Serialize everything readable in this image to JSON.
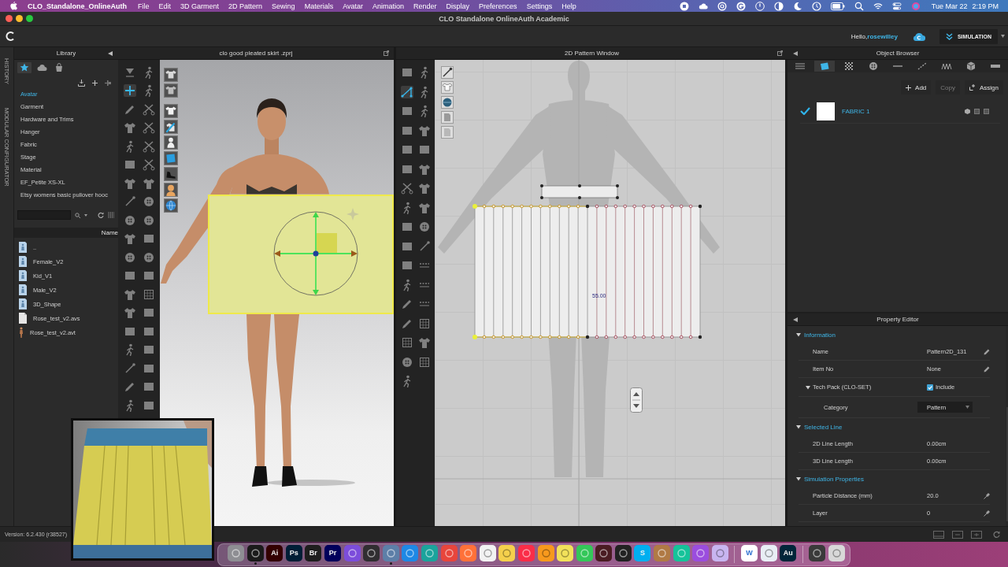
{
  "menu_bar": {
    "app_name": "CLO_Standalone_OnlineAuth",
    "menus": [
      "File",
      "Edit",
      "3D Garment",
      "2D Pattern",
      "Sewing",
      "Materials",
      "Avatar",
      "Animation",
      "Render",
      "Display",
      "Preferences",
      "Settings",
      "Help"
    ],
    "date": "Tue Mar 22",
    "time": "2:19 PM"
  },
  "window": {
    "title": "CLO Standalone OnlineAuth Academic"
  },
  "top_bar": {
    "greeting": "Hello,",
    "user": "rosewilley",
    "mode_button": "SIMULATION"
  },
  "side_strip": {
    "tabs": [
      "HISTORY",
      "MODULAR CONFIGURATOR"
    ]
  },
  "library": {
    "title": "Library",
    "tabs": [
      {
        "selected": true
      },
      {
        "selected": false
      },
      {
        "selected": false
      }
    ],
    "categories": [
      {
        "label": "Avatar",
        "selected": true
      },
      {
        "label": "Garment",
        "selected": false
      },
      {
        "label": "Hardware and Trims",
        "selected": false
      },
      {
        "label": "Hanger",
        "selected": false
      },
      {
        "label": "Fabric",
        "selected": false
      },
      {
        "label": "Stage",
        "selected": false
      },
      {
        "label": "Material",
        "selected": false
      },
      {
        "label": "EF_Petite XS-XL",
        "selected": false
      },
      {
        "label": "Etsy womens basic pullover hooc",
        "selected": false
      }
    ],
    "column_header": "Name",
    "files": [
      {
        "kind": "folder",
        "name": ".."
      },
      {
        "kind": "folder",
        "name": "Female_V2"
      },
      {
        "kind": "folder",
        "name": "Kid_V1"
      },
      {
        "kind": "folder",
        "name": "Male_V2"
      },
      {
        "kind": "folder",
        "name": "3D_Shape"
      },
      {
        "kind": "file",
        "name": "Rose_test_v2.avs"
      },
      {
        "kind": "avatar",
        "name": "Rose_test_v2.avt"
      }
    ]
  },
  "viewport_3d": {
    "title": "clo good pleated skirt .zprj",
    "piece_selected": true,
    "tools": [
      {
        "selected": false
      },
      {
        "selected": false
      },
      {
        "selected": true
      },
      {
        "selected": false
      },
      {
        "selected": false
      },
      {
        "selected": false
      },
      {
        "selected": false
      },
      {
        "selected": false
      },
      {
        "selected": false
      },
      {
        "selected": false
      },
      {
        "selected": false
      },
      {
        "selected": false
      },
      {
        "selected": false
      },
      {
        "selected": false
      },
      {
        "selected": false
      },
      {
        "selected": false
      },
      {
        "selected": false
      },
      {
        "selected": false
      },
      {
        "selected": false
      },
      {
        "selected": false
      },
      {
        "selected": false
      },
      {
        "selected": false
      },
      {
        "selected": false
      },
      {
        "selected": false
      },
      {
        "selected": false
      },
      {
        "selected": false
      },
      {
        "selected": false
      },
      {
        "selected": false
      },
      {
        "selected": false
      },
      {
        "selected": false
      },
      {
        "selected": false
      },
      {
        "selected": false
      },
      {
        "selected": false
      },
      {
        "selected": false
      },
      {
        "selected": false
      },
      {
        "selected": false
      },
      {
        "selected": false
      },
      {
        "selected": false
      }
    ]
  },
  "pattern_window": {
    "title": "2D Pattern Window",
    "measure": "55.00",
    "tools": [
      {
        "selected": false
      },
      {
        "selected": false
      },
      {
        "selected": true
      },
      {
        "selected": false
      },
      {
        "selected": false
      },
      {
        "selected": false
      },
      {
        "selected": false
      },
      {
        "selected": false
      },
      {
        "selected": false
      },
      {
        "selected": false
      },
      {
        "selected": false
      },
      {
        "selected": false
      },
      {
        "selected": false
      },
      {
        "selected": false
      },
      {
        "selected": false
      },
      {
        "selected": false
      },
      {
        "selected": false
      },
      {
        "selected": false
      },
      {
        "selected": false
      },
      {
        "selected": false
      },
      {
        "selected": false
      },
      {
        "selected": false
      },
      {
        "selected": false
      },
      {
        "selected": false
      },
      {
        "selected": false
      },
      {
        "selected": false
      },
      {
        "selected": false
      },
      {
        "selected": false
      },
      {
        "selected": false
      },
      {
        "selected": false
      },
      {
        "selected": false
      },
      {
        "selected": false
      },
      {
        "selected": false
      }
    ]
  },
  "object_browser": {
    "title": "Object Browser",
    "tabs": [
      {
        "selected": false
      },
      {
        "selected": true
      },
      {
        "selected": false
      },
      {
        "selected": false
      },
      {
        "selected": false
      },
      {
        "selected": false
      },
      {
        "selected": false
      },
      {
        "selected": false
      },
      {
        "selected": false
      }
    ],
    "actions": [
      {
        "label": "Add",
        "disabled": false
      },
      {
        "label": "Copy",
        "disabled": true
      },
      {
        "label": "Assign",
        "disabled": false
      }
    ],
    "fabrics": [
      {
        "name": "FABRIC 1",
        "checked": true,
        "color": "#ffffff"
      }
    ]
  },
  "property_editor": {
    "title": "Property Editor",
    "sections": [
      {
        "title": "Information",
        "expanded": true,
        "rows": [
          {
            "kind": "editable",
            "label": "Name",
            "value": "Pattern2D_131"
          },
          {
            "kind": "editable",
            "label": "Item No",
            "value": "None"
          },
          {
            "kind": "checkbox",
            "label": "Tech Pack (CLO-SET)",
            "checked": true,
            "value": "Include",
            "expanded": true,
            "children": [
              {
                "kind": "dropdown",
                "label": "Category",
                "value": "Pattern"
              }
            ]
          }
        ]
      },
      {
        "title": "Selected Line",
        "expanded": true,
        "rows": [
          {
            "kind": "readonly",
            "label": "2D Line Length",
            "value": "0.00cm"
          },
          {
            "kind": "readonly",
            "label": "3D Line Length",
            "value": "0.00cm"
          }
        ]
      },
      {
        "title": "Simulation Properties",
        "expanded": true,
        "rows": [
          {
            "kind": "pinned",
            "label": "Particle Distance (mm)",
            "value": "20.0"
          },
          {
            "kind": "pinned",
            "label": "Layer",
            "value": "0"
          }
        ]
      }
    ]
  },
  "status_bar": {
    "version": "Version: 6.2.430 (r38527)"
  },
  "dock": {
    "apps": [
      {
        "kind": "app",
        "color": "#8e8e93",
        "running": false
      },
      {
        "kind": "app",
        "color": "#1b1b1b",
        "running": true
      },
      {
        "kind": "app",
        "color": "#330000",
        "glyph": "Ai",
        "running": false
      },
      {
        "kind": "app",
        "color": "#001e36",
        "glyph": "Ps",
        "running": false
      },
      {
        "kind": "app",
        "color": "#1e1e1e",
        "glyph": "Br",
        "running": false
      },
      {
        "kind": "app",
        "color": "#00005b",
        "glyph": "Pr",
        "running": false
      },
      {
        "kind": "app",
        "color": "#7c4ddb",
        "running": false
      },
      {
        "kind": "app",
        "color": "#302e31",
        "running": false
      },
      {
        "kind": "app",
        "color": "#5d7fa8",
        "running": true
      },
      {
        "kind": "app",
        "color": "#1e88e5",
        "running": false
      },
      {
        "kind": "app",
        "color": "#1ba39c",
        "running": false
      },
      {
        "kind": "app",
        "color": "#e8453c",
        "running": false
      },
      {
        "kind": "app",
        "color": "#ff7139",
        "running": false
      },
      {
        "kind": "app",
        "color": "#f2f2f2",
        "running": false
      },
      {
        "kind": "app",
        "color": "#f5d04c",
        "running": false
      },
      {
        "kind": "app",
        "color": "#fa2d48",
        "running": false
      },
      {
        "kind": "app",
        "color": "#f7991d",
        "running": false
      },
      {
        "kind": "app",
        "color": "#f2e15a",
        "running": false
      },
      {
        "kind": "app",
        "color": "#34c759",
        "running": false
      },
      {
        "kind": "app",
        "color": "#4a1c22",
        "running": false
      },
      {
        "kind": "app",
        "color": "#222222",
        "running": false
      },
      {
        "kind": "app",
        "color": "#00aff0",
        "glyph": "S",
        "running": false
      },
      {
        "kind": "app",
        "color": "#b07a45",
        "running": false
      },
      {
        "kind": "app",
        "color": "#15c39a",
        "running": false
      },
      {
        "kind": "app",
        "color": "#9b4dde",
        "running": false
      },
      {
        "kind": "app",
        "color": "#c8b5f0",
        "running": false
      },
      {
        "kind": "separator"
      },
      {
        "kind": "app",
        "color": "#ffffff",
        "glyph": "W",
        "running": false
      },
      {
        "kind": "app",
        "color": "#e8eef5",
        "running": false
      },
      {
        "kind": "app",
        "color": "#00263a",
        "glyph": "Au",
        "running": false
      },
      {
        "kind": "separator"
      },
      {
        "kind": "app",
        "color": "#3a3a3a",
        "running": false
      },
      {
        "kind": "app",
        "color": "#d8d8d8",
        "running": false
      }
    ]
  }
}
